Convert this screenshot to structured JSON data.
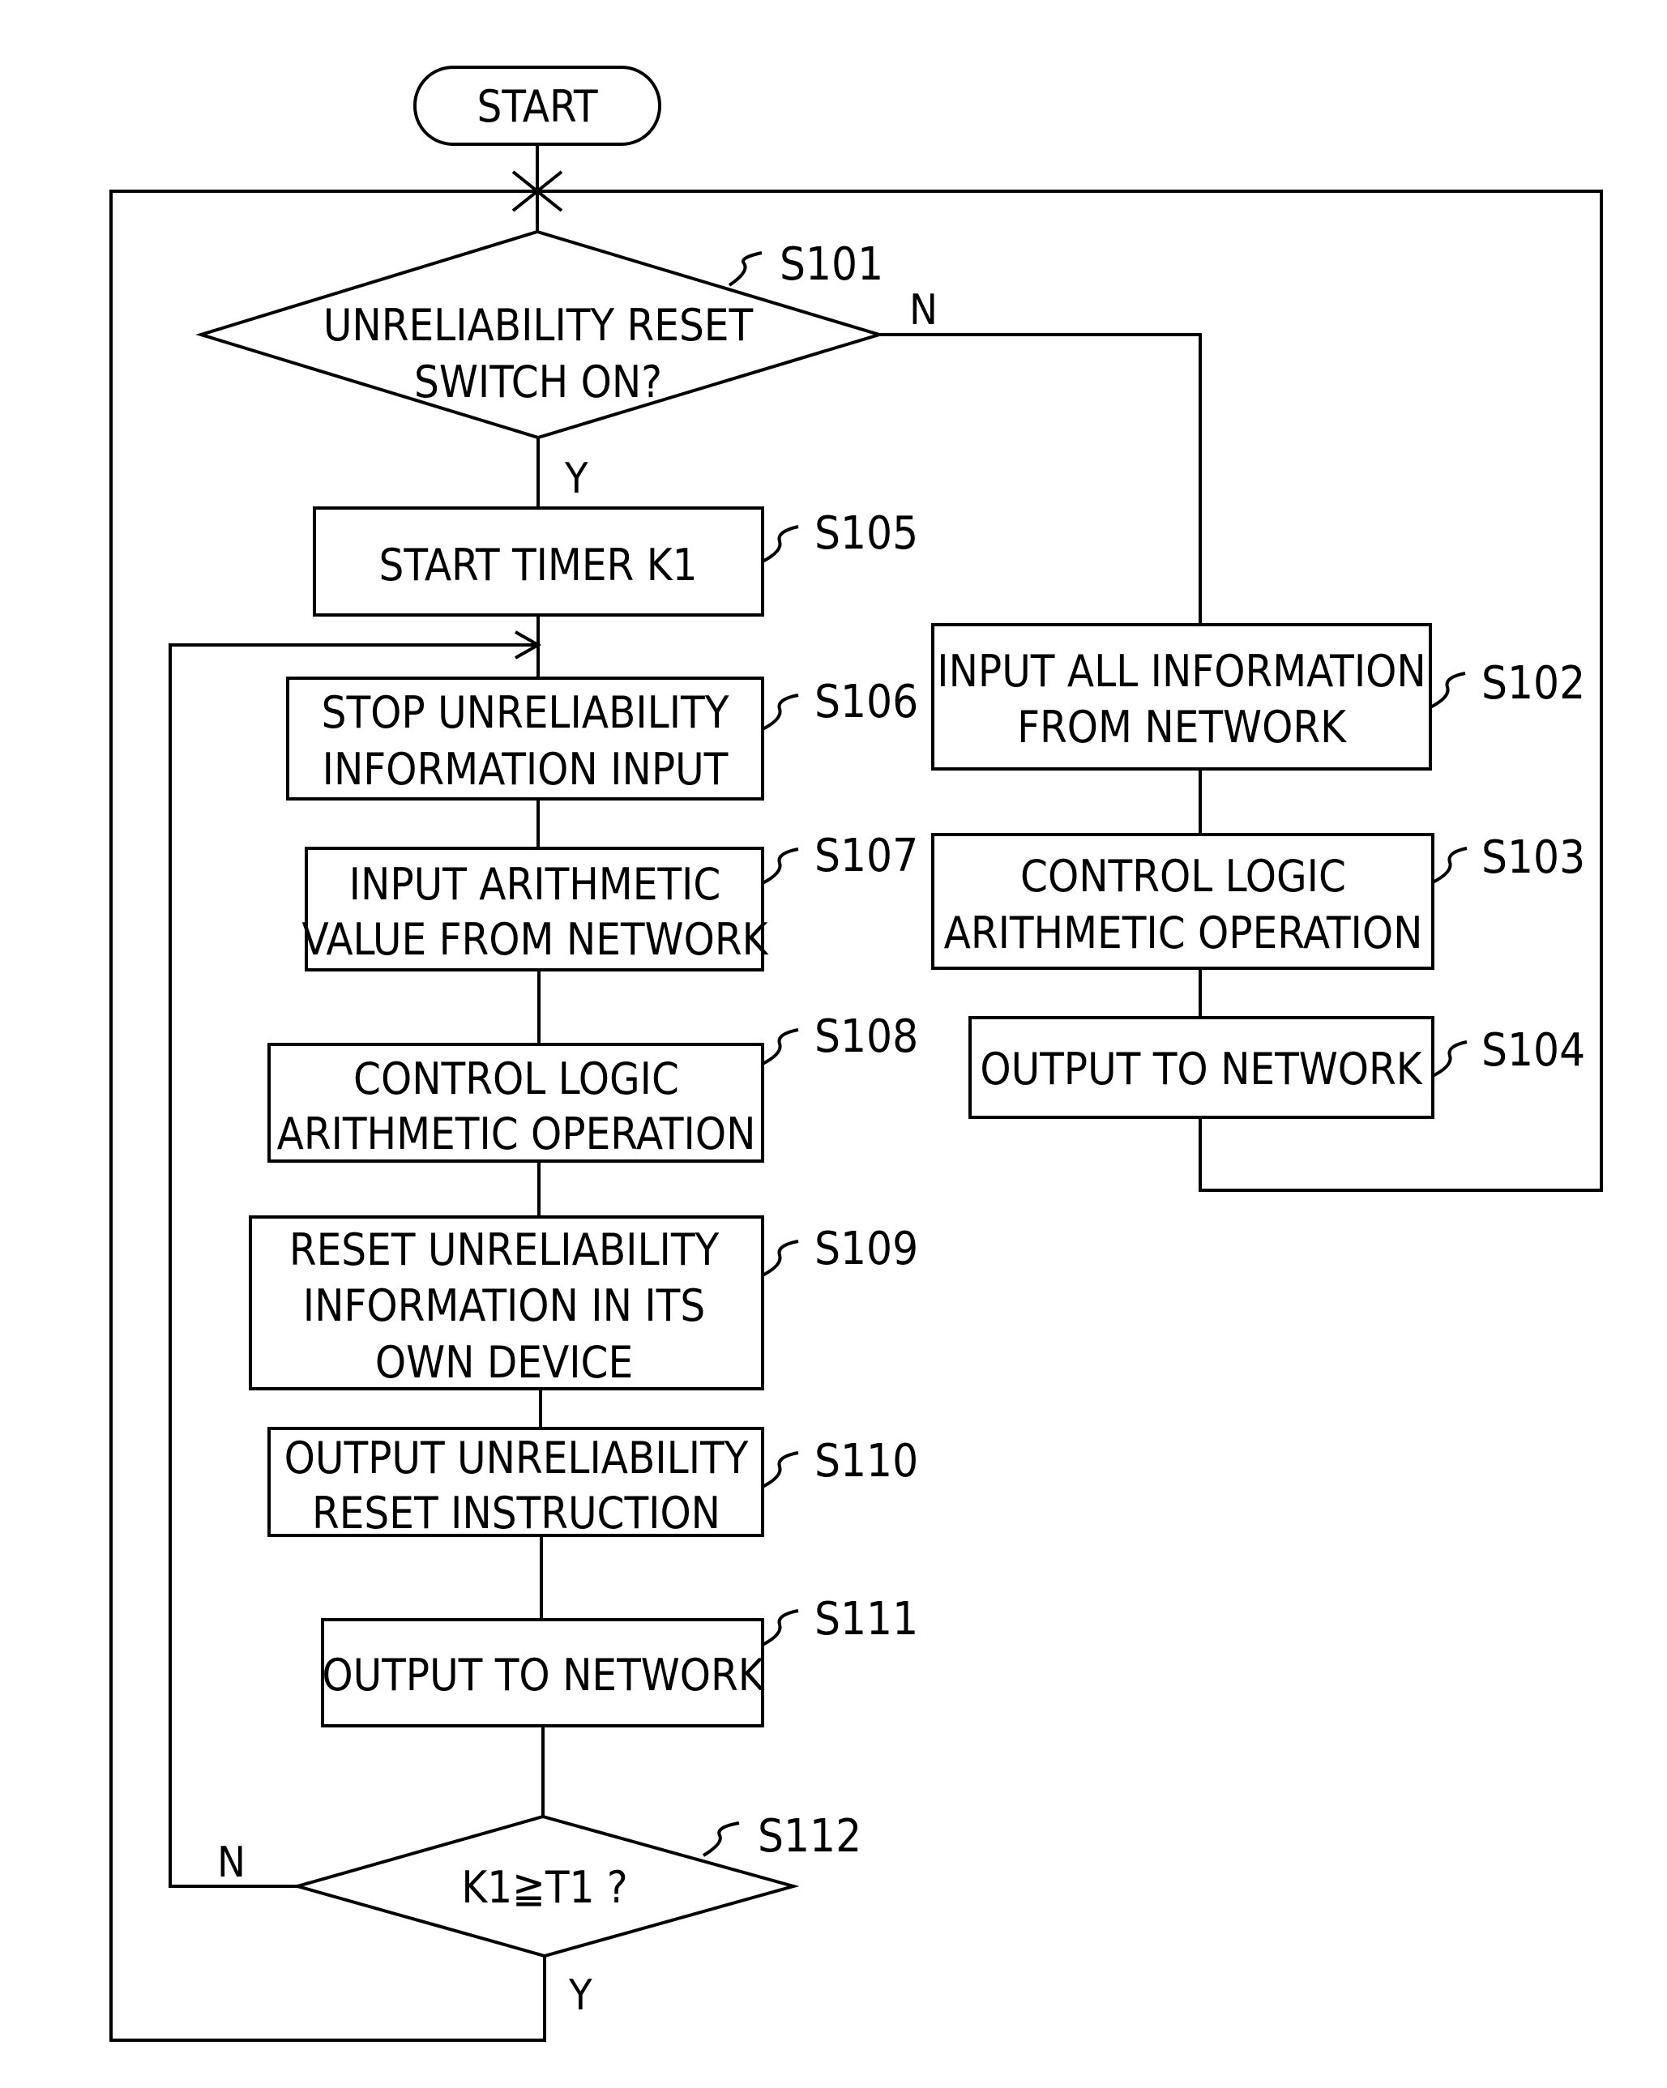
{
  "diagram": {
    "type": "flowchart",
    "start": {
      "label": "START"
    },
    "nodes": [
      {
        "id": "S101",
        "kind": "decision",
        "lines": [
          "UNRELIABILITY RESET",
          "SWITCH ON?"
        ],
        "step": "S101",
        "yes_label": "Y",
        "no_label": "N"
      },
      {
        "id": "S105",
        "kind": "process",
        "lines": [
          "START TIMER K1"
        ],
        "step": "S105"
      },
      {
        "id": "S106",
        "kind": "process",
        "lines": [
          "STOP UNRELIABILITY",
          "INFORMATION INPUT"
        ],
        "step": "S106"
      },
      {
        "id": "S107",
        "kind": "process",
        "lines": [
          "INPUT ARITHMETIC",
          "VALUE FROM NETWORK"
        ],
        "step": "S107"
      },
      {
        "id": "S108",
        "kind": "process",
        "lines": [
          "CONTROL LOGIC",
          "ARITHMETIC OPERATION"
        ],
        "step": "S108"
      },
      {
        "id": "S109",
        "kind": "process",
        "lines": [
          "RESET UNRELIABILITY",
          "INFORMATION IN ITS",
          "OWN DEVICE"
        ],
        "step": "S109"
      },
      {
        "id": "S110",
        "kind": "process",
        "lines": [
          "OUTPUT UNRELIABILITY",
          "RESET INSTRUCTION"
        ],
        "step": "S110"
      },
      {
        "id": "S111",
        "kind": "process",
        "lines": [
          "OUTPUT TO NETWORK"
        ],
        "step": "S111"
      },
      {
        "id": "S112",
        "kind": "decision",
        "lines": [
          "K1≧T1 ?"
        ],
        "step": "S112",
        "yes_label": "Y",
        "no_label": "N"
      },
      {
        "id": "S102",
        "kind": "process",
        "lines": [
          "INPUT ALL INFORMATION",
          "FROM NETWORK"
        ],
        "step": "S102"
      },
      {
        "id": "S103",
        "kind": "process",
        "lines": [
          "CONTROL LOGIC",
          "ARITHMETIC OPERATION"
        ],
        "step": "S103"
      },
      {
        "id": "S104",
        "kind": "process",
        "lines": [
          "OUTPUT TO NETWORK"
        ],
        "step": "S104"
      }
    ],
    "edges": [
      {
        "from": "START",
        "to": "S101"
      },
      {
        "from": "S101",
        "to": "S105",
        "label": "Y"
      },
      {
        "from": "S101",
        "to": "S102",
        "label": "N"
      },
      {
        "from": "S105",
        "to": "S106"
      },
      {
        "from": "S106",
        "to": "S107"
      },
      {
        "from": "S107",
        "to": "S108"
      },
      {
        "from": "S108",
        "to": "S109"
      },
      {
        "from": "S109",
        "to": "S110"
      },
      {
        "from": "S110",
        "to": "S111"
      },
      {
        "from": "S111",
        "to": "S112"
      },
      {
        "from": "S112",
        "to": "S106",
        "label": "N"
      },
      {
        "from": "S112",
        "to": "S101",
        "label": "Y"
      },
      {
        "from": "S102",
        "to": "S103"
      },
      {
        "from": "S103",
        "to": "S104"
      },
      {
        "from": "S104",
        "to": "S101"
      }
    ]
  }
}
